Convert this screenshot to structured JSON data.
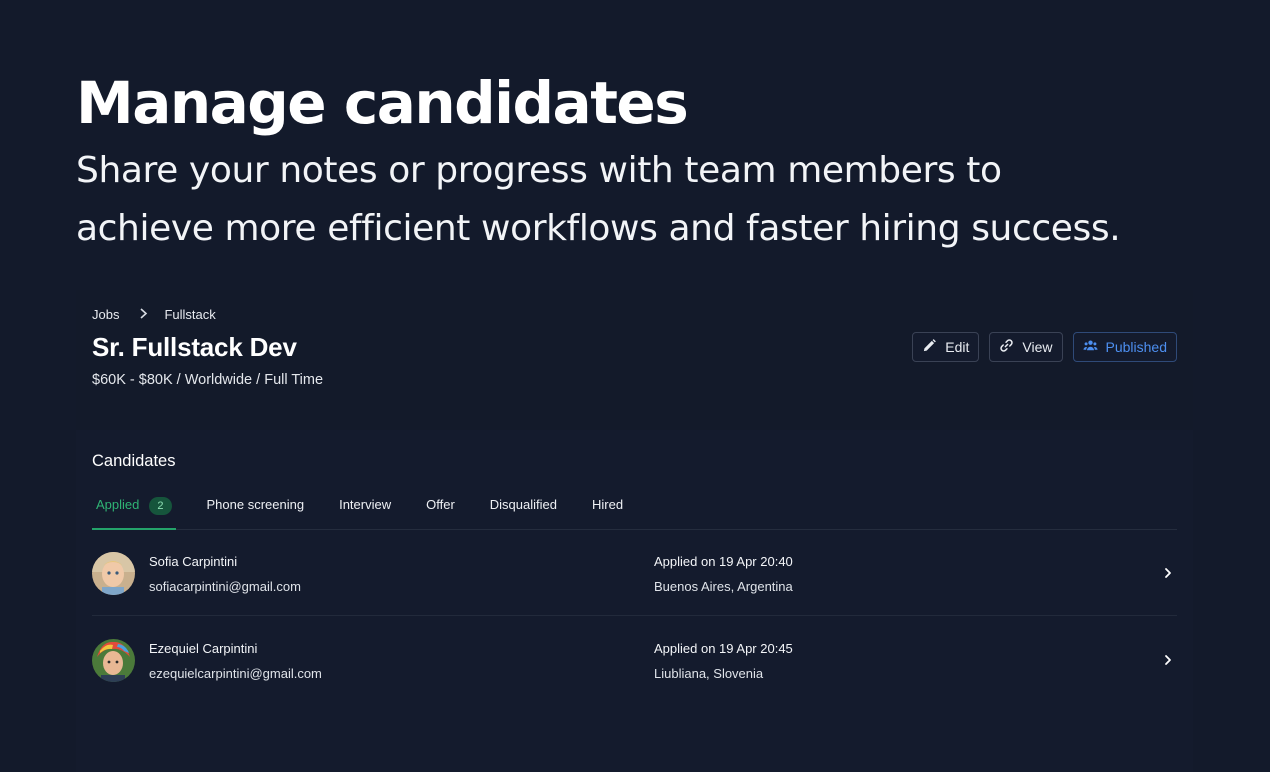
{
  "hero": {
    "title": "Manage candidates",
    "subtitle_line1": "Share your notes or progress with team members to",
    "subtitle_line2": "achieve more efficient workflows and faster hiring success."
  },
  "breadcrumb": {
    "items": [
      "Jobs",
      "Fullstack"
    ],
    "separator_icon": "chevron-right-icon"
  },
  "job": {
    "title": "Sr. Fullstack Dev",
    "meta": "$60K - $80K / Worldwide / Full Time"
  },
  "actions": {
    "edit_label": "Edit",
    "view_label": "View",
    "published_label": "Published",
    "edit_icon": "pencil-icon",
    "view_icon": "link-icon",
    "published_icon": "users-icon"
  },
  "candidates": {
    "title": "Candidates",
    "tabs": [
      {
        "label": "Applied",
        "count": "2",
        "active": true
      },
      {
        "label": "Phone screening"
      },
      {
        "label": "Interview"
      },
      {
        "label": "Offer"
      },
      {
        "label": "Disqualified"
      },
      {
        "label": "Hired"
      }
    ],
    "rows": [
      {
        "name": "Sofia Carpintini",
        "email": "sofiacarpintini@gmail.com",
        "applied": "Applied on 19 Apr 20:40",
        "location": "Buenos Aires, Argentina"
      },
      {
        "name": "Ezequiel Carpintini",
        "email": "ezequielcarpintini@gmail.com",
        "applied": "Applied on 19 Apr 20:45",
        "location": "Liubliana, Slovenia"
      }
    ]
  },
  "colors": {
    "background": "#131a2b",
    "accent_green": "#2fb374",
    "accent_blue": "#4d8ff0"
  }
}
